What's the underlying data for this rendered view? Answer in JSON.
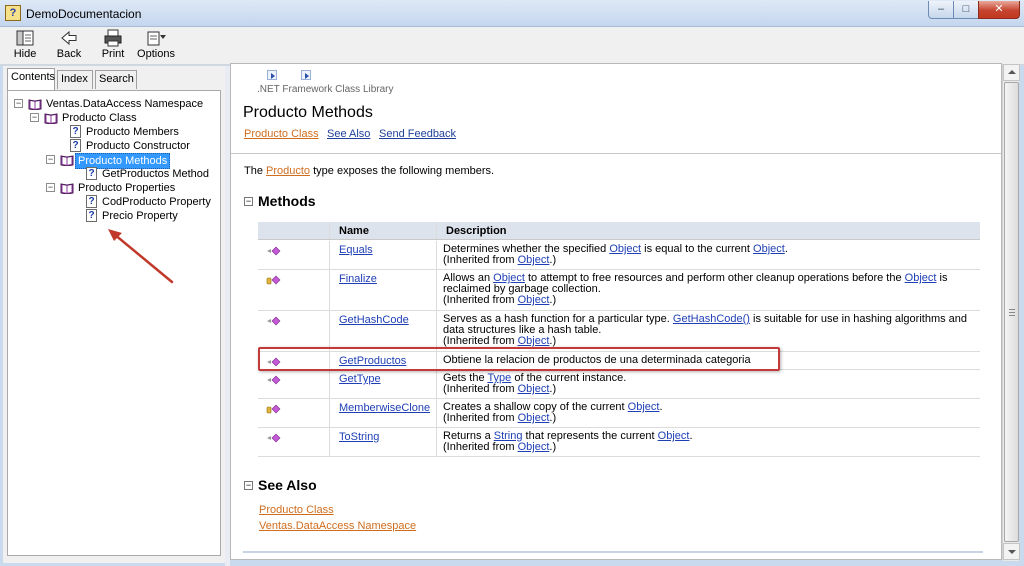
{
  "window": {
    "title": "DemoDocumentacion",
    "app_icon_glyph": "?"
  },
  "window_controls": {
    "minimize": "‒",
    "maximize": "□",
    "close": "✕"
  },
  "toolbar": {
    "hide": "Hide",
    "back": "Back",
    "print": "Print",
    "options": "Options"
  },
  "tabs": {
    "contents": "Contents",
    "index": "Index",
    "search": "Search"
  },
  "tree": {
    "ns": "Ventas.DataAccess Namespace",
    "cls": "Producto Class",
    "members": "Producto Members",
    "ctor": "Producto Constructor",
    "methods": "Producto Methods",
    "getproductos": "GetProductos Method",
    "properties": "Producto Properties",
    "codproducto": "CodProducto Property",
    "precio": "Precio Property"
  },
  "header": {
    "library": ".NET Framework Class Library",
    "title": "Producto Methods",
    "link_class": "Producto Class",
    "link_seealso": "See Also",
    "link_feedback": "Send Feedback"
  },
  "intro": {
    "pre": "The ",
    "link": "Producto",
    "post": " type exposes the following members."
  },
  "methods": {
    "heading": "Methods",
    "col_name": "Name",
    "col_desc": "Description",
    "rows": [
      {
        "name": "Equals",
        "icon": "public-method-icon",
        "d1": "Determines whether the specified ",
        "l1": "Object",
        "d2": " is equal to the current ",
        "l2": "Object",
        "d3": ".",
        "inh": "(Inherited from ",
        "inhl": "Object",
        "inhe": ".)"
      },
      {
        "name": "Finalize",
        "icon": "protected-method-icon",
        "d1": "Allows an ",
        "l1": "Object",
        "d2": " to attempt to free resources and perform other cleanup operations before the ",
        "l2": "Object",
        "d3": " is reclaimed by garbage collection.",
        "inh": "(Inherited from ",
        "inhl": "Object",
        "inhe": ".)"
      },
      {
        "name": "GetHashCode",
        "icon": "public-method-icon",
        "d1": "Serves as a hash function for a particular type. ",
        "l1": "GetHashCode()",
        "d2": " is suitable for use in hashing algorithms and data structures like a hash table.",
        "inh": "(Inherited from ",
        "inhl": "Object",
        "inhe": ".)"
      },
      {
        "name": "GetProductos",
        "icon": "public-method-icon",
        "d1": "Obtiene la relacion de productos de una determinada categoria"
      },
      {
        "name": "GetType",
        "icon": "public-method-icon",
        "d1": "Gets the ",
        "l1": "Type",
        "d2": " of the current instance.",
        "inh": "(Inherited from ",
        "inhl": "Object",
        "inhe": ".)"
      },
      {
        "name": "MemberwiseClone",
        "icon": "protected-method-icon",
        "d1": "Creates a shallow copy of the current ",
        "l1": "Object",
        "d2": ".",
        "inh": "(Inherited from ",
        "inhl": "Object",
        "inhe": ".)"
      },
      {
        "name": "ToString",
        "icon": "public-method-icon",
        "d1": "Returns a ",
        "l1": "String",
        "d2": " that represents the current ",
        "l2": "Object",
        "d3": ".",
        "inh": "(Inherited from ",
        "inhl": "Object",
        "inhe": ".)"
      }
    ]
  },
  "seealso": {
    "heading": "See Also",
    "link1": "Producto Class",
    "link2": "Ventas.DataAccess Namespace"
  },
  "colors": {
    "link_orange": "#d06d1e",
    "link_blue": "#1f3fb5",
    "highlight": "#c43a3a",
    "selection": "#3399ff"
  }
}
